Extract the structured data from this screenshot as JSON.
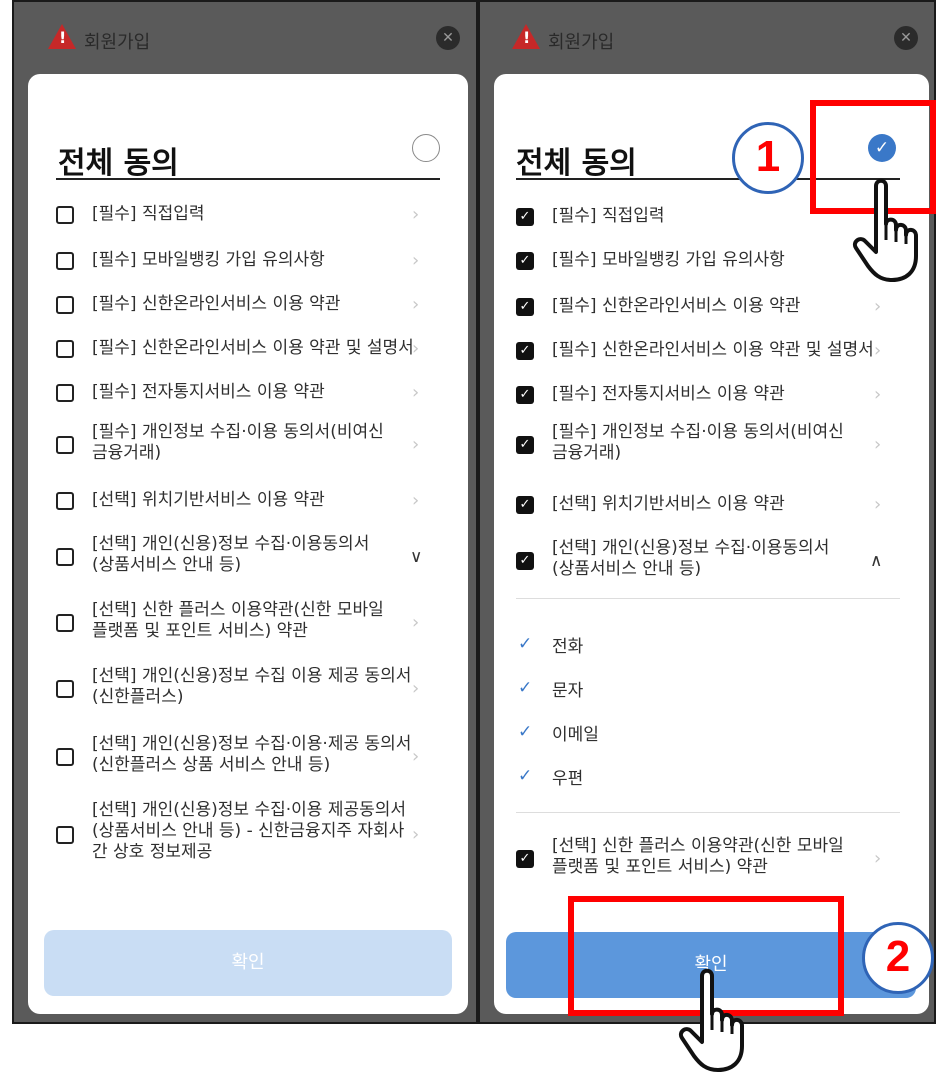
{
  "left": {
    "title": "회원가입",
    "all_agree": "전체 동의",
    "items": [
      {
        "label": "[필수] 직접입력"
      },
      {
        "label": "[필수] 모바일뱅킹 가입 유의사항"
      },
      {
        "label": "[필수] 신한온라인서비스 이용 약관"
      },
      {
        "label": "[필수] 신한온라인서비스 이용 약관 및 설명서"
      },
      {
        "label": "[필수] 전자통지서비스 이용 약관"
      },
      {
        "label1": "[필수] 개인정보 수집·이용 동의서(비여신",
        "label2": "금융거래)"
      },
      {
        "label": "[선택] 위치기반서비스 이용 약관"
      },
      {
        "label1": "[선택] 개인(신용)정보 수집·이용동의서",
        "label2": "(상품서비스 안내 등)"
      },
      {
        "label1": "[선택] 신한 플러스 이용약관(신한 모바일",
        "label2": "플랫폼 및 포인트 서비스) 약관"
      },
      {
        "label1": "[선택] 개인(신용)정보 수집 이용 제공 동의서",
        "label2": "(신한플러스)"
      },
      {
        "label1": "[선택] 개인(신용)정보 수집·이용·제공 동의서",
        "label2": "(신한플러스 상품 서비스 안내 등)"
      },
      {
        "label1": "[선택] 개인(신용)정보 수집·이용 제공동의서",
        "label2": "(상품서비스 안내 등) - 신한금융지주 자회사",
        "label3": "간 상호 정보제공"
      }
    ],
    "confirm": "확인"
  },
  "right": {
    "title": "회원가입",
    "all_agree": "전체 동의",
    "items": [
      {
        "label": "[필수] 직접입력"
      },
      {
        "label": "[필수] 모바일뱅킹 가입 유의사항"
      },
      {
        "label": "[필수] 신한온라인서비스 이용 약관"
      },
      {
        "label": "[필수] 신한온라인서비스 이용 약관 및 설명서"
      },
      {
        "label": "[필수] 전자통지서비스 이용 약관"
      },
      {
        "label1": "[필수] 개인정보 수집·이용 동의서(비여신",
        "label2": "금융거래)"
      },
      {
        "label": "[선택] 위치기반서비스 이용 약관"
      },
      {
        "label1": "[선택] 개인(신용)정보 수집·이용동의서",
        "label2": "(상품서비스 안내 등)"
      },
      {
        "label1": "[선택] 신한 플러스 이용약관(신한 모바일",
        "label2": "플랫폼 및 포인트 서비스) 약관"
      }
    ],
    "sub_options": [
      "전화",
      "문자",
      "이메일",
      "우편"
    ],
    "confirm": "확인"
  },
  "markers": [
    "1",
    "2"
  ],
  "colors": {
    "highlight": "#ff0000",
    "accent": "#3a78c8",
    "confirm_disabled": "#c9ddf4",
    "confirm_enabled": "#5c97dc"
  }
}
